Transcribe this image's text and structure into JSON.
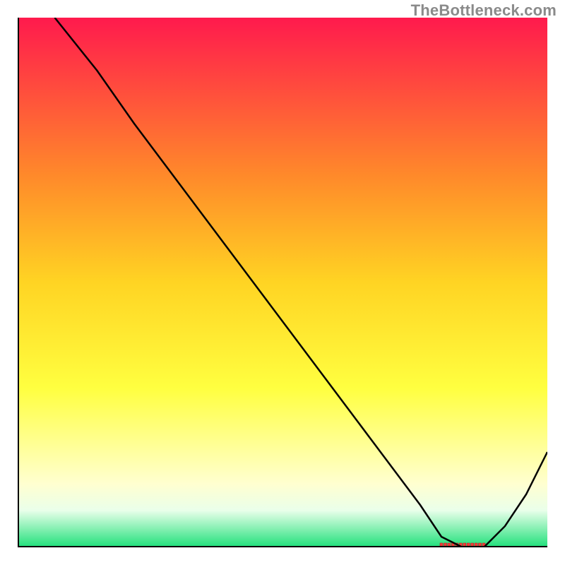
{
  "watermark": "TheBottleneck.com",
  "colors": {
    "axis": "#000000",
    "curve": "#000000",
    "watermark": "#8a8a8a",
    "marker_fill": "#ff3a3a",
    "marker_stroke": "#b02020",
    "grad_top": "#ff1a4d",
    "grad_mid_upper": "#ff8a2a",
    "grad_mid": "#ffd423",
    "grad_mid_lower": "#ffff40",
    "grad_pale": "#ffffd0",
    "grad_pale2": "#eaffea",
    "grad_green": "#1fe07a"
  },
  "chart_data": {
    "type": "line",
    "title": "",
    "xlabel": "",
    "ylabel": "",
    "xlim": [
      0,
      100
    ],
    "ylim": [
      0,
      100
    ],
    "grid": false,
    "legend": false,
    "series": [
      {
        "name": "curve",
        "x": [
          7,
          15,
          22,
          28,
          34,
          40,
          46,
          52,
          58,
          64,
          70,
          76,
          80,
          84,
          88,
          92,
          96,
          100
        ],
        "y": [
          100,
          90,
          80,
          72,
          64,
          56,
          48,
          40,
          32,
          24,
          16,
          8,
          2,
          0,
          0,
          4,
          10,
          18
        ]
      }
    ],
    "marker": {
      "x_start": 80,
      "x_end": 88,
      "y": 0
    },
    "background_gradient": {
      "stops": [
        {
          "offset": 0.0,
          "key": "grad_top"
        },
        {
          "offset": 0.3,
          "key": "grad_mid_upper"
        },
        {
          "offset": 0.5,
          "key": "grad_mid"
        },
        {
          "offset": 0.7,
          "key": "grad_mid_lower"
        },
        {
          "offset": 0.88,
          "key": "grad_pale"
        },
        {
          "offset": 0.93,
          "key": "grad_pale2"
        },
        {
          "offset": 1.0,
          "key": "grad_green"
        }
      ]
    }
  }
}
